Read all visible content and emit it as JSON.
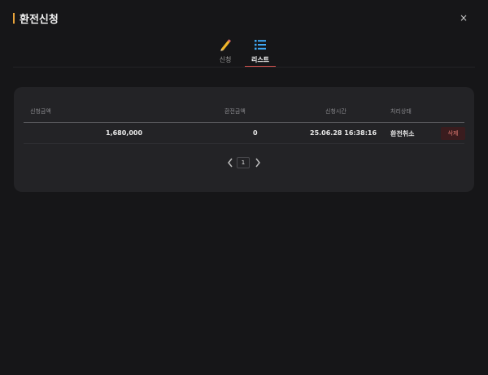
{
  "dialog": {
    "title": "환전신청",
    "close_label": "×",
    "accent_color": "#e8a33a"
  },
  "tabs": [
    {
      "label": "신청",
      "icon": "pencil-icon",
      "active": false
    },
    {
      "label": "리스트",
      "icon": "list-icon",
      "active": true
    }
  ],
  "table": {
    "columns": [
      "신청금액",
      "환전금액",
      "신청시간",
      "처리상태"
    ],
    "rows": [
      {
        "request_amount": "1,680,000",
        "exchange_amount": "0",
        "request_time": "25.06.28 16:38:16",
        "status": "환전취소",
        "delete_label": "삭제"
      }
    ]
  },
  "pagination": {
    "current_page": "1"
  }
}
